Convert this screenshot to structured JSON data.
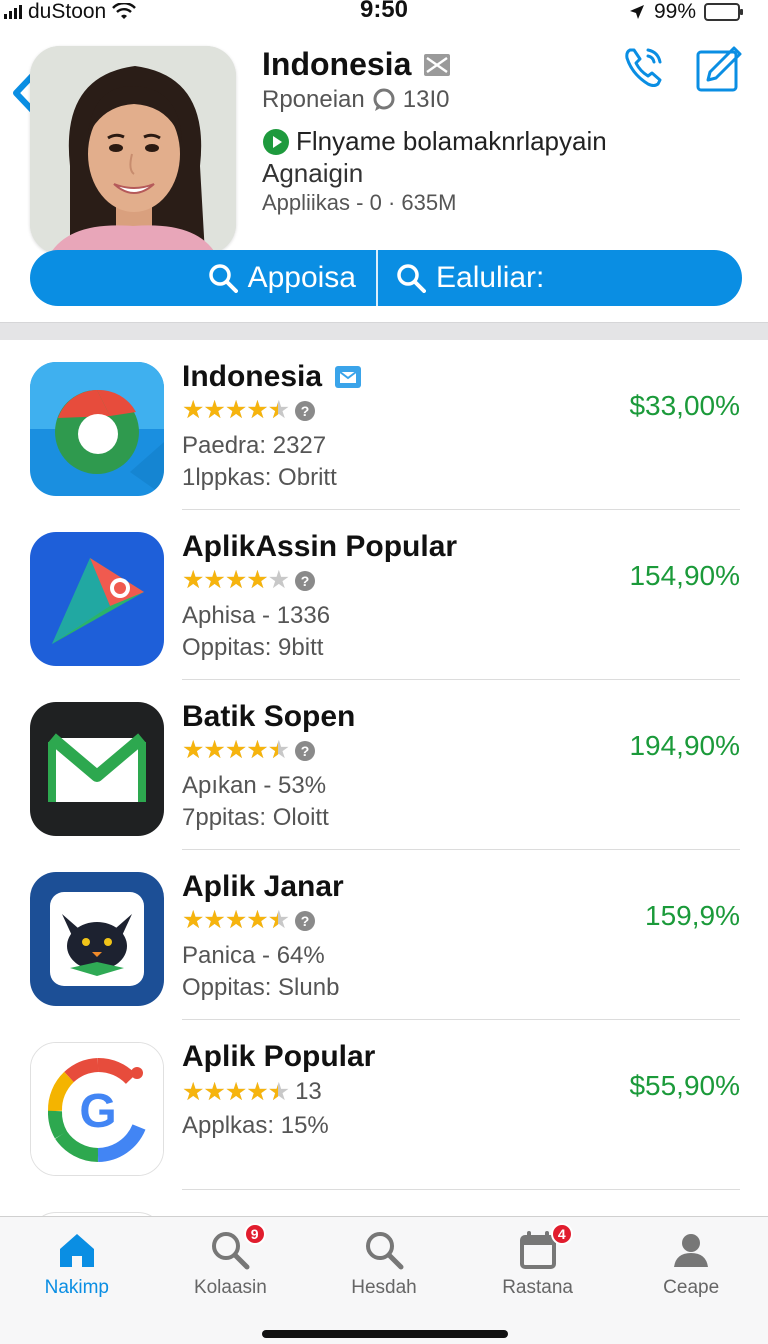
{
  "status_bar": {
    "carrier": "duStoon",
    "time": "9:50",
    "battery": "99%",
    "battery_level": 0.95
  },
  "header": {
    "back_icon": "chevron-left-icon",
    "title": "Indonesia",
    "title_badge_icon": "envelope-icon",
    "subtitle": "Rponeian",
    "subtitle_count": "13I0",
    "line3": "Flnyame bolamaknrlapyain",
    "line4": "Agnaigin",
    "line5": "Appliikas - 0 · 635M",
    "phone_icon": "phone-icon",
    "edit_icon": "compose-icon",
    "actions": {
      "left_label": "Appoisa",
      "right_label": "Ealuliar:"
    }
  },
  "apps": [
    {
      "name": "Indonesia",
      "badge_icon": "mail-badge-icon",
      "rating": 4.5,
      "meta1": "Paedra: 2327",
      "meta2": "1lppkas: Obritt",
      "price": "$33,00%",
      "icon": "chrome-icon"
    },
    {
      "name": "AplikAssin Popular",
      "rating": 4.0,
      "meta1": "Aphisa - 1336",
      "meta2": "Oppitas: 9bitt",
      "price": "154,90%",
      "icon": "maps-icon"
    },
    {
      "name": "Batik Sopen",
      "rating": 4.5,
      "meta1": "Apıkan - 53%",
      "meta2": "7ppitas: Oloitt",
      "price": "194,90%",
      "icon": "mail-icon"
    },
    {
      "name": "Aplik Janar",
      "rating": 4.5,
      "meta1": "Panica - 64%",
      "meta2": "Oppitas: Slunb",
      "price": "159,9%",
      "icon": "cat-icon"
    },
    {
      "name": "Aplik Popular",
      "rating": 4.5,
      "rating_count": "13",
      "meta1": "Applkas: 15%",
      "meta2": "",
      "price": "$55,90%",
      "icon": "google-icon"
    }
  ],
  "tabs": [
    {
      "label": "Nakimp",
      "icon": "home-icon",
      "badge": "",
      "active": true
    },
    {
      "label": "Kolaasin",
      "icon": "search-icon",
      "badge": "9",
      "active": false
    },
    {
      "label": "Hesdah",
      "icon": "search-icon",
      "badge": "",
      "active": false
    },
    {
      "label": "Rastana",
      "icon": "calendar-icon",
      "badge": "4",
      "active": false
    },
    {
      "label": "Ceape",
      "icon": "profile-icon",
      "badge": "",
      "active": false
    }
  ]
}
